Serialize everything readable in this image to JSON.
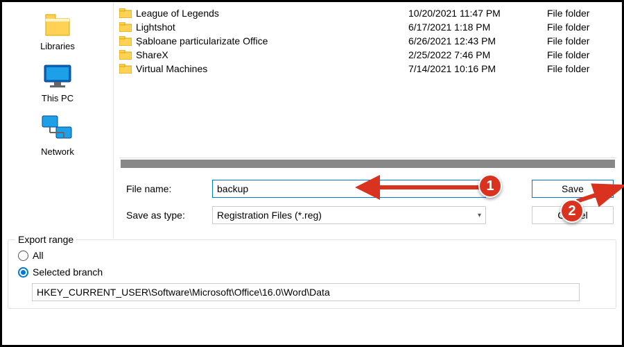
{
  "nav": {
    "items": [
      {
        "label": "Libraries",
        "icon": "libraries"
      },
      {
        "label": "This PC",
        "icon": "thispc"
      },
      {
        "label": "Network",
        "icon": "network"
      }
    ]
  },
  "files": [
    {
      "name": "League of Legends",
      "date": "10/20/2021 11:47 PM",
      "type": "File folder"
    },
    {
      "name": "Lightshot",
      "date": "6/17/2021 1:18 PM",
      "type": "File folder"
    },
    {
      "name": "Șabloane particularizate Office",
      "date": "6/26/2021 12:43 PM",
      "type": "File folder"
    },
    {
      "name": "ShareX",
      "date": "2/25/2022 7:46 PM",
      "type": "File folder"
    },
    {
      "name": "Virtual Machines",
      "date": "7/14/2021 10:16 PM",
      "type": "File folder"
    }
  ],
  "form": {
    "filename_label": "File name:",
    "filename_value": "backup",
    "type_label": "Save as type:",
    "type_value": "Registration Files (*.reg)",
    "save_label": "Save",
    "cancel_label": "Cancel"
  },
  "export": {
    "legend": "Export range",
    "all_label": "All",
    "selected_label": "Selected branch",
    "branch_value": "HKEY_CURRENT_USER\\Software\\Microsoft\\Office\\16.0\\Word\\Data"
  },
  "annotations": {
    "one": "1",
    "two": "2"
  }
}
